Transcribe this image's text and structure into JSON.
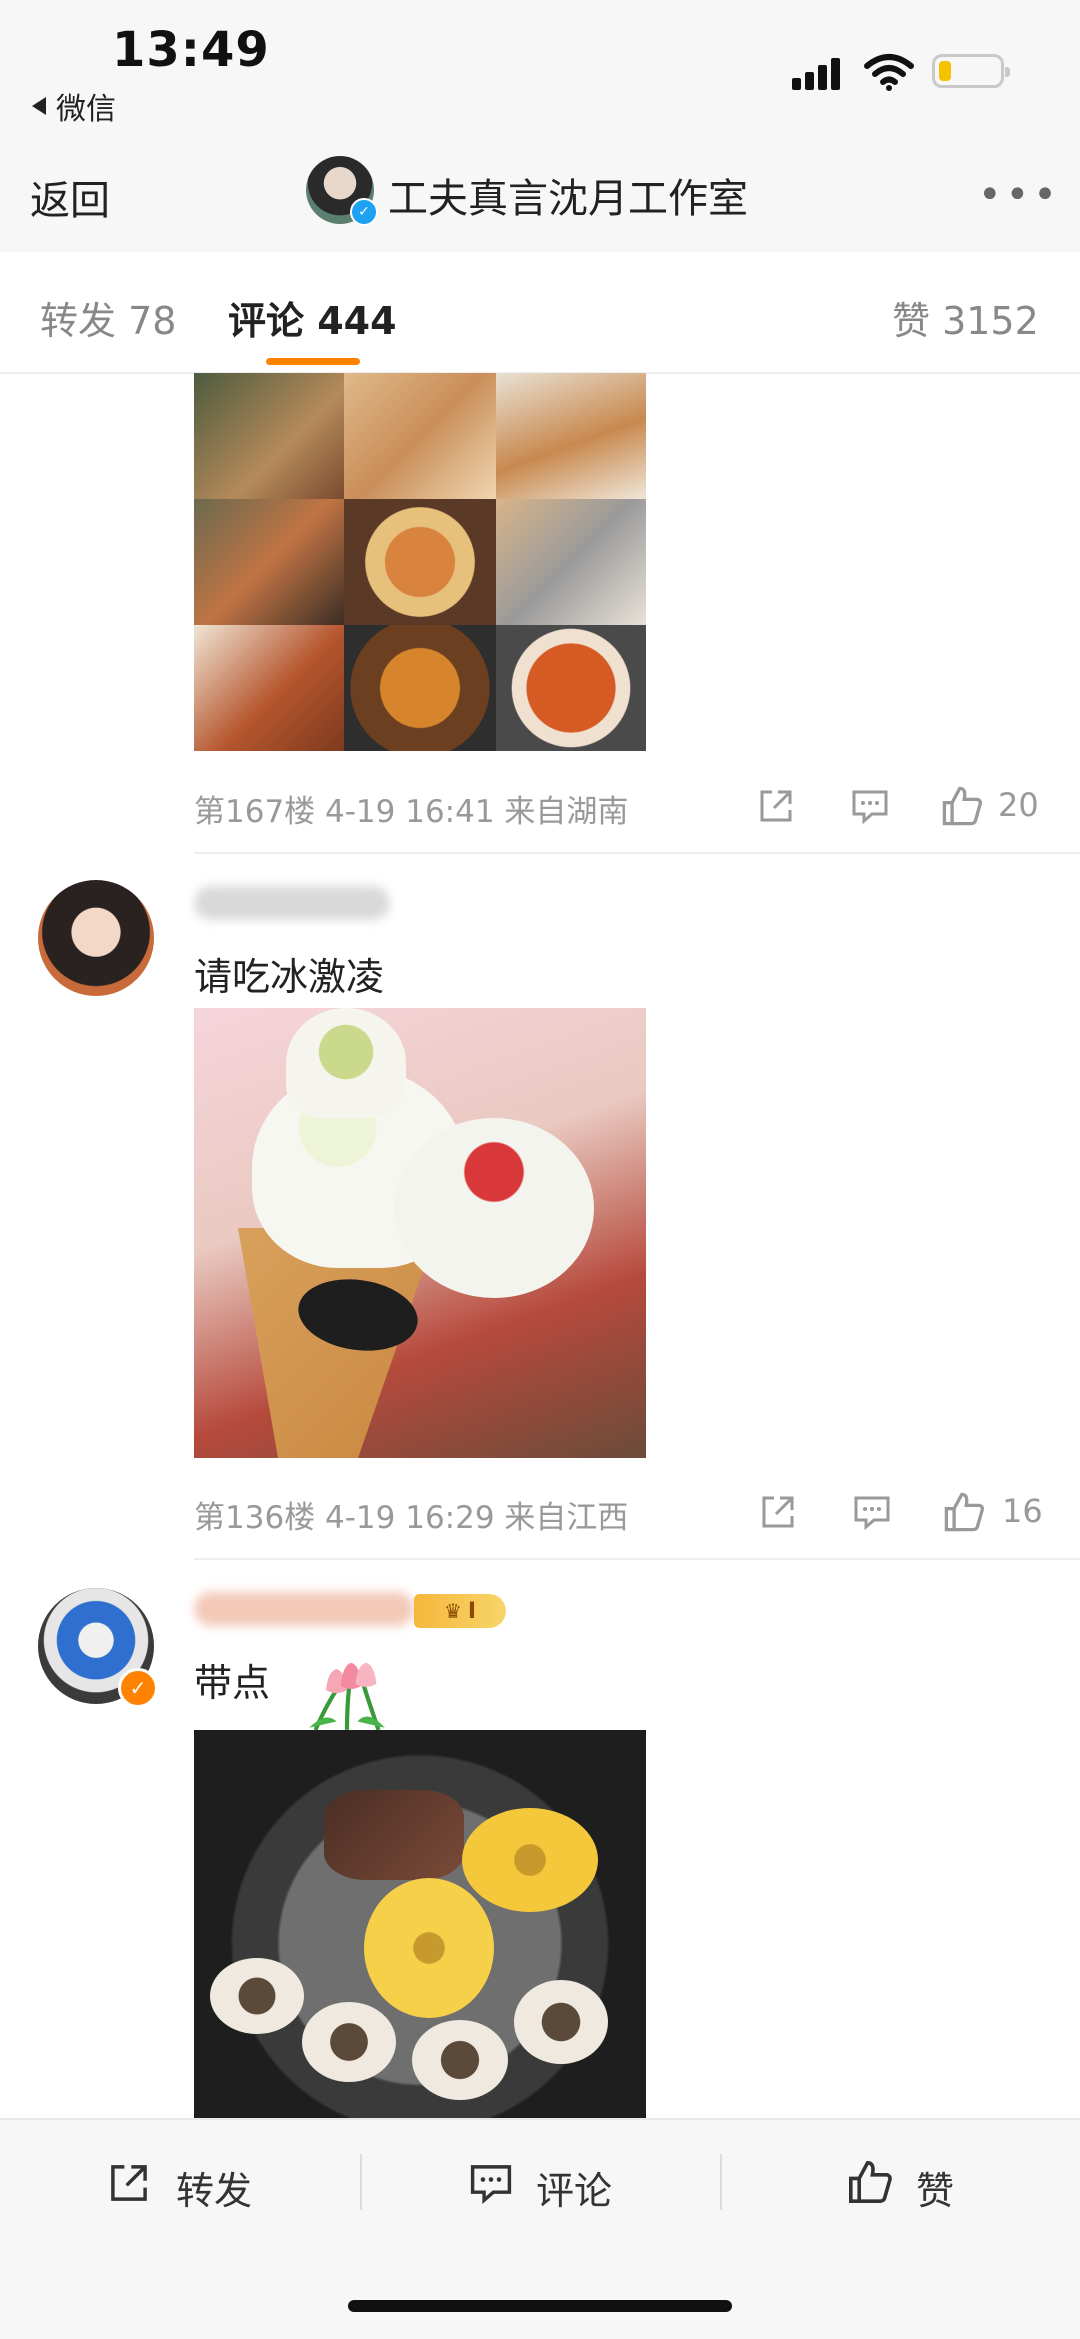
{
  "status": {
    "time": "13:49",
    "back_app": "微信"
  },
  "nav": {
    "back_label": "返回",
    "title": "工夫真言沈月工作室",
    "more": "•••"
  },
  "tabs": {
    "repost": "转发 78",
    "comment": "评论 444",
    "like": "赞 3152"
  },
  "comments": [
    {
      "floor_meta": "第167楼 4-19 16:41 来自湖南",
      "likes": "20"
    },
    {
      "text": "请吃冰激凌",
      "floor_meta": "第136楼 4-19 16:29 来自江西",
      "likes": "16"
    },
    {
      "text": "带点",
      "badge_label": "I"
    }
  ],
  "bottom": {
    "repost": "转发",
    "comment": "评论",
    "like": "赞"
  },
  "colors": {
    "accent": "#ff8200",
    "verified_blue": "#1da1f2",
    "verified_orange": "#ff8200"
  }
}
